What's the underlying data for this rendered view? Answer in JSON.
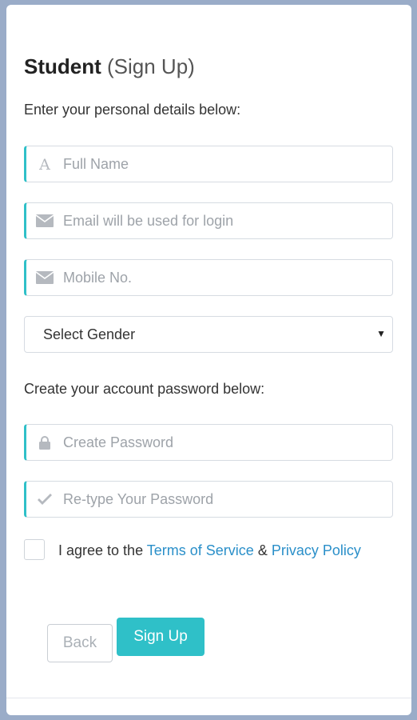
{
  "header": {
    "title_strong": "Student",
    "title_light": "(Sign Up)"
  },
  "personal": {
    "label": "Enter your personal details below:",
    "full_name": {
      "placeholder": "Full Name",
      "icon": "font-icon"
    },
    "email": {
      "placeholder": "Email will be used for login",
      "icon": "envelope-icon"
    },
    "mobile": {
      "placeholder": "Mobile No.",
      "icon": "envelope-icon"
    },
    "gender": {
      "selected": "Select Gender",
      "icon": "caret-down-icon"
    }
  },
  "password": {
    "label": "Create your account password below:",
    "create": {
      "placeholder": "Create Password",
      "icon": "lock-icon"
    },
    "retype": {
      "placeholder": "Re-type Your Password",
      "icon": "check-icon"
    }
  },
  "agree": {
    "checked": false,
    "prefix": "I agree to the ",
    "terms_link": "Terms of Service",
    "amp": " & ",
    "privacy_link": "Privacy Policy"
  },
  "buttons": {
    "back": "Back",
    "signup": "Sign Up"
  },
  "colors": {
    "accent": "#2fc0c8",
    "link": "#2a8fc9",
    "background": "#9aacc8"
  }
}
